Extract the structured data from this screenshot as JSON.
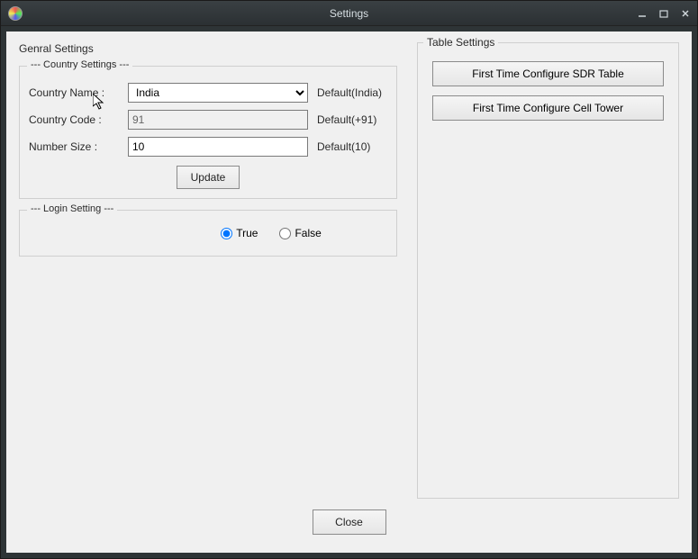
{
  "window": {
    "title": "Settings"
  },
  "general": {
    "title": "Genral Settings",
    "country": {
      "legend": "--- Country Settings ---",
      "name_label": "Country Name :",
      "name_value": "India",
      "name_hint": "Default(India)",
      "code_label": "Country Code :",
      "code_value": "91",
      "code_hint": "Default(+91)",
      "num_label": "Number Size :",
      "num_value": "10",
      "num_hint": "Default(10)",
      "update_label": "Update"
    },
    "login": {
      "legend": "--- Login Setting ---",
      "true_label": "True",
      "false_label": "False"
    }
  },
  "table": {
    "title": "Table Settings",
    "btn1": "First Time Configure SDR Table",
    "btn2": "First Time Configure Cell Tower"
  },
  "footer": {
    "close": "Close"
  }
}
